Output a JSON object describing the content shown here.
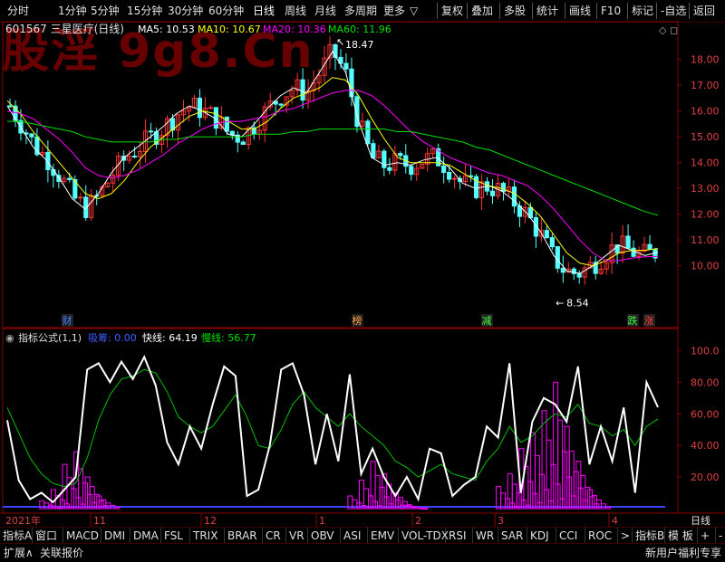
{
  "toolbar": {
    "periods": [
      "分时",
      "1分钟",
      "5分钟",
      "15分钟",
      "30分钟",
      "60分钟",
      "日线",
      "周线",
      "月线",
      "多周期",
      "更多"
    ],
    "actions": [
      "复权",
      "叠加",
      "多股",
      "统计",
      "画线",
      "F10",
      "标记",
      "-自选",
      "返回"
    ],
    "more_arrow": "▽"
  },
  "watermark": "股淫 9g8.Cn",
  "stock": {
    "title": "601567 三星医疗(日线)",
    "ma5": "MA5: 10.53",
    "ma10": "MA10: 10.67",
    "ma20": "MA20: 10.36",
    "ma60": "MA60: 11.96",
    "high_label": "18.47",
    "low_label": "8.54",
    "colors": {
      "up": "#ff3232",
      "down": "#54ffff",
      "ma5": "#ffffff",
      "ma10": "#ffff00",
      "ma20": "#ff00ff",
      "ma60": "#00e000"
    }
  },
  "event_markers": [
    {
      "label": "财",
      "color": "#4080ff"
    },
    {
      "label": "榜",
      "color": "#ffa040"
    },
    {
      "label": "减",
      "color": "#40ff40"
    },
    {
      "label": "跌",
      "color": "#40ff40"
    },
    {
      "label": "涨",
      "color": "#ff4040"
    }
  ],
  "indicator": {
    "title": "指标公式(1,1)",
    "zero_label": "吸筹: 0.00",
    "fast_label": "快线: 64.19",
    "slow_label": "慢线: 56.77"
  },
  "time_axis": [
    "2021年",
    "11",
    "12",
    "1",
    "2",
    "3",
    "4",
    "日线"
  ],
  "bottom_tabs": [
    "指标A",
    "窗口",
    "MACD",
    "DMI",
    "DMA",
    "FSL",
    "TRIX",
    "BRAR",
    "CR",
    "VR",
    "OBV",
    "ASI",
    "EMV",
    "VOL-TDX",
    "RSI",
    "WR",
    "SAR",
    "KDJ",
    "CCI",
    "ROC",
    ">",
    "指标B",
    "模 板",
    "+",
    "-"
  ],
  "status_bar": {
    "expand": "扩展∧",
    "quote": "关联报价",
    "right_text": "新用户福利专享"
  },
  "chart_data": [
    {
      "type": "candlestick",
      "title": "601567 三星医疗(日线)",
      "ylim": [
        8.2,
        18.9
      ],
      "yticks": [
        10.0,
        11.0,
        12.0,
        13.0,
        14.0,
        15.0,
        16.0,
        17.0,
        18.0
      ],
      "x": [
        "2021年",
        "11",
        "12",
        "1",
        "2",
        "3",
        "4"
      ],
      "annotations": [
        {
          "text": "18.47",
          "value": 18.47
        },
        {
          "text": "8.54",
          "value": 8.54
        }
      ],
      "series": [
        {
          "name": "MA5",
          "values": [
            16.2,
            15.4,
            14.6,
            14.1,
            13.4,
            12.6,
            12.2,
            12.8,
            13.6,
            14.2,
            14.6,
            15.0,
            15.4,
            15.9,
            16.2,
            16.0,
            15.7,
            15.1,
            15.0,
            15.5,
            16.1,
            16.6,
            16.9,
            16.7,
            17.5,
            18.3,
            17.5,
            15.6,
            14.2,
            13.9,
            14.0,
            13.9,
            14.1,
            14.2,
            13.8,
            13.2,
            13.0,
            13.1,
            12.9,
            12.5,
            12.0,
            11.3,
            10.4,
            9.8,
            9.7,
            10.0,
            10.4,
            10.8,
            10.6,
            10.4,
            10.53
          ]
        },
        {
          "name": "MA10",
          "values": [
            16.4,
            15.9,
            15.2,
            14.6,
            14.0,
            13.4,
            12.8,
            12.6,
            12.8,
            13.3,
            14.0,
            14.6,
            15.0,
            15.4,
            15.8,
            16.0,
            15.9,
            15.6,
            15.3,
            15.3,
            15.6,
            16.1,
            16.5,
            16.7,
            16.9,
            17.3,
            17.2,
            16.6,
            15.7,
            14.9,
            14.2,
            14.0,
            14.0,
            14.0,
            13.9,
            13.6,
            13.3,
            13.1,
            13.0,
            12.8,
            12.4,
            11.9,
            11.2,
            10.5,
            10.1,
            10.0,
            10.2,
            10.5,
            10.6,
            10.6,
            10.67
          ]
        },
        {
          "name": "MA20",
          "values": [
            16.0,
            15.9,
            15.7,
            15.3,
            14.9,
            14.4,
            13.8,
            13.5,
            13.4,
            13.5,
            13.7,
            14.0,
            14.3,
            14.7,
            15.0,
            15.3,
            15.5,
            15.6,
            15.6,
            15.7,
            15.8,
            16.0,
            16.1,
            16.3,
            16.5,
            16.7,
            16.8,
            16.8,
            16.6,
            16.2,
            15.7,
            15.2,
            14.8,
            14.5,
            14.2,
            14.0,
            13.8,
            13.6,
            13.5,
            13.3,
            13.1,
            12.7,
            12.2,
            11.6,
            11.0,
            10.5,
            10.2,
            10.2,
            10.3,
            10.35,
            10.36
          ]
        },
        {
          "name": "MA60",
          "values": [
            15.6,
            15.6,
            15.5,
            15.4,
            15.3,
            15.2,
            15.0,
            14.9,
            14.8,
            14.8,
            14.8,
            14.8,
            14.9,
            14.9,
            15.0,
            15.0,
            15.0,
            15.0,
            15.0,
            15.1,
            15.1,
            15.1,
            15.2,
            15.2,
            15.3,
            15.3,
            15.3,
            15.3,
            15.3,
            15.3,
            15.2,
            15.2,
            15.1,
            15.0,
            14.9,
            14.8,
            14.6,
            14.5,
            14.3,
            14.1,
            13.9,
            13.7,
            13.5,
            13.3,
            13.1,
            12.9,
            12.7,
            12.5,
            12.3,
            12.1,
            11.96
          ]
        }
      ]
    },
    {
      "type": "line",
      "title": "指标公式(1,1)",
      "ylim": [
        0,
        110
      ],
      "yticks": [
        20.0,
        40.0,
        60.0,
        80.0,
        100.0
      ],
      "series": [
        {
          "name": "快线",
          "values": [
            56,
            18,
            6,
            10,
            4,
            12,
            20,
            88,
            92,
            80,
            93,
            82,
            96,
            78,
            42,
            28,
            52,
            38,
            66,
            90,
            84,
            8,
            12,
            40,
            88,
            92,
            72,
            28,
            60,
            30,
            85,
            22,
            38,
            20,
            8,
            20,
            6,
            38,
            35,
            8,
            15,
            20,
            52,
            45,
            92,
            10,
            55,
            70,
            66,
            55,
            90,
            28,
            52,
            30,
            64,
            10,
            80,
            64.19
          ]
        },
        {
          "name": "慢线",
          "values": [
            64,
            48,
            32,
            22,
            16,
            14,
            16,
            32,
            56,
            72,
            82,
            84,
            88,
            86,
            74,
            58,
            52,
            48,
            52,
            62,
            72,
            58,
            40,
            38,
            50,
            66,
            74,
            64,
            58,
            52,
            60,
            52,
            46,
            40,
            30,
            26,
            20,
            24,
            28,
            22,
            20,
            18,
            30,
            38,
            52,
            42,
            46,
            54,
            60,
            58,
            66,
            54,
            52,
            46,
            50,
            40,
            52,
            56.77
          ]
        },
        {
          "name": "吸筹",
          "values": [
            0,
            0,
            0,
            5,
            12,
            28,
            36,
            20,
            8,
            0,
            0,
            0,
            0,
            0,
            0,
            0,
            0,
            0,
            0,
            0,
            0,
            0,
            0,
            0,
            0,
            0,
            0,
            0,
            0,
            0,
            8,
            18,
            30,
            22,
            10,
            2,
            0,
            0,
            0,
            0,
            0,
            0,
            0,
            14,
            22,
            38,
            48,
            62,
            80,
            52,
            30,
            12,
            0,
            0,
            0,
            0,
            0,
            0
          ]
        }
      ]
    }
  ]
}
